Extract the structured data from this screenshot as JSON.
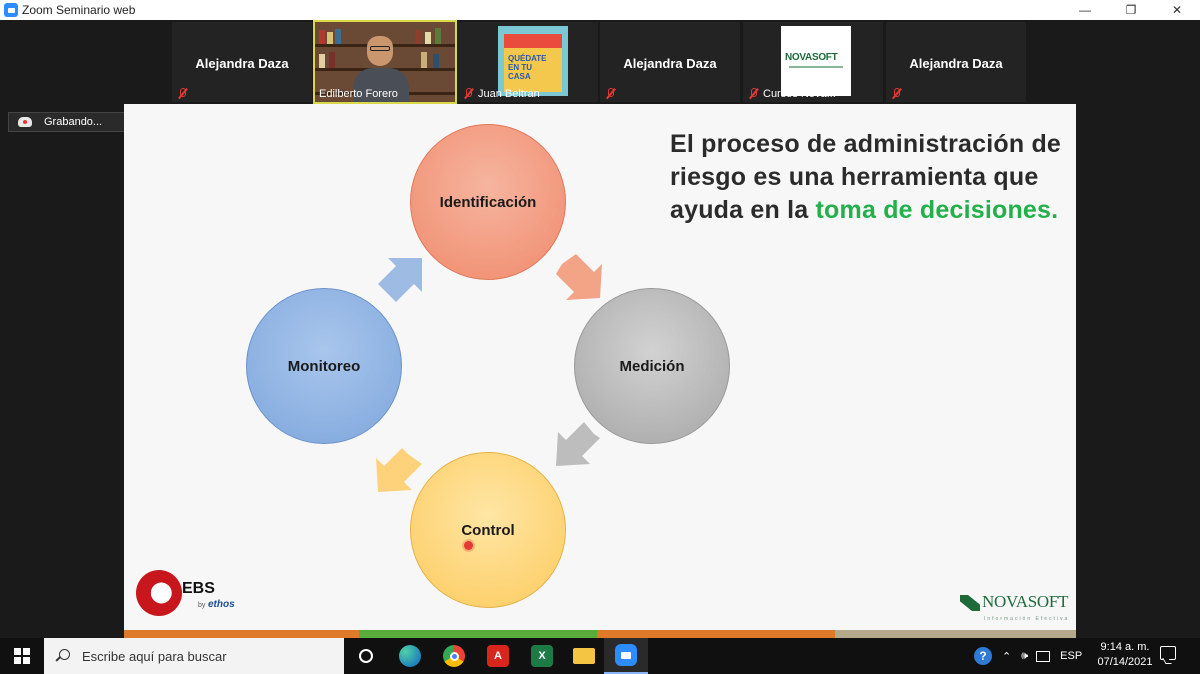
{
  "window": {
    "title": "Zoom Seminario web",
    "controls": {
      "minimize": "—",
      "restore": "❐",
      "close": "✕"
    }
  },
  "participants": [
    {
      "name": "Alejandra Daza",
      "label": "",
      "video": "none"
    },
    {
      "name": "",
      "label": "Edilberto Forero",
      "video": "camera"
    },
    {
      "name": "",
      "label": "Juan Beltran",
      "video": "poster"
    },
    {
      "name": "Alejandra Daza",
      "label": "",
      "video": "none"
    },
    {
      "name": "",
      "label": "Cursos Nova...",
      "video": "logo"
    },
    {
      "name": "Alejandra Daza",
      "label": "",
      "video": "none"
    }
  ],
  "poster_text": "QUÉDATE\nEN TU\nCASA",
  "poster_logo": "NOVASOFT",
  "recording": {
    "label": "Grabando..."
  },
  "slide": {
    "circles": {
      "identificacion": "Identificación",
      "medicion": "Medición",
      "control": "Control",
      "monitoreo": "Monitoreo"
    },
    "heading_plain": "El proceso de administración de riesgo es una herramienta que ayuda en la ",
    "heading_highlight": "toma de decisiones.",
    "logos": {
      "ebs": "EBS",
      "ebs_by": "by",
      "ethos": "ethos",
      "novasoft": "NOVASOFT",
      "novasoft_sub": "Información Efectiva"
    },
    "bottom_bar_colors": [
      "#e07a2b",
      "#5aaa3c",
      "#e07a2b",
      "#b5a98b"
    ]
  },
  "taskbar": {
    "search_placeholder": "Escribe aquí para buscar",
    "apps": [
      "task-view",
      "edge",
      "chrome",
      "acrobat",
      "excel",
      "file-explorer",
      "zoom"
    ],
    "tray": {
      "help": "?",
      "language": "ESP"
    },
    "clock": {
      "time": "9:14 a. m.",
      "date": "07/14/2021"
    }
  },
  "colors": {
    "identificacion": "#f08a6c",
    "medicion": "#a6a6a6",
    "control": "#fcca5e",
    "monitoreo": "#7da6dc",
    "highlight": "#22b04b"
  }
}
